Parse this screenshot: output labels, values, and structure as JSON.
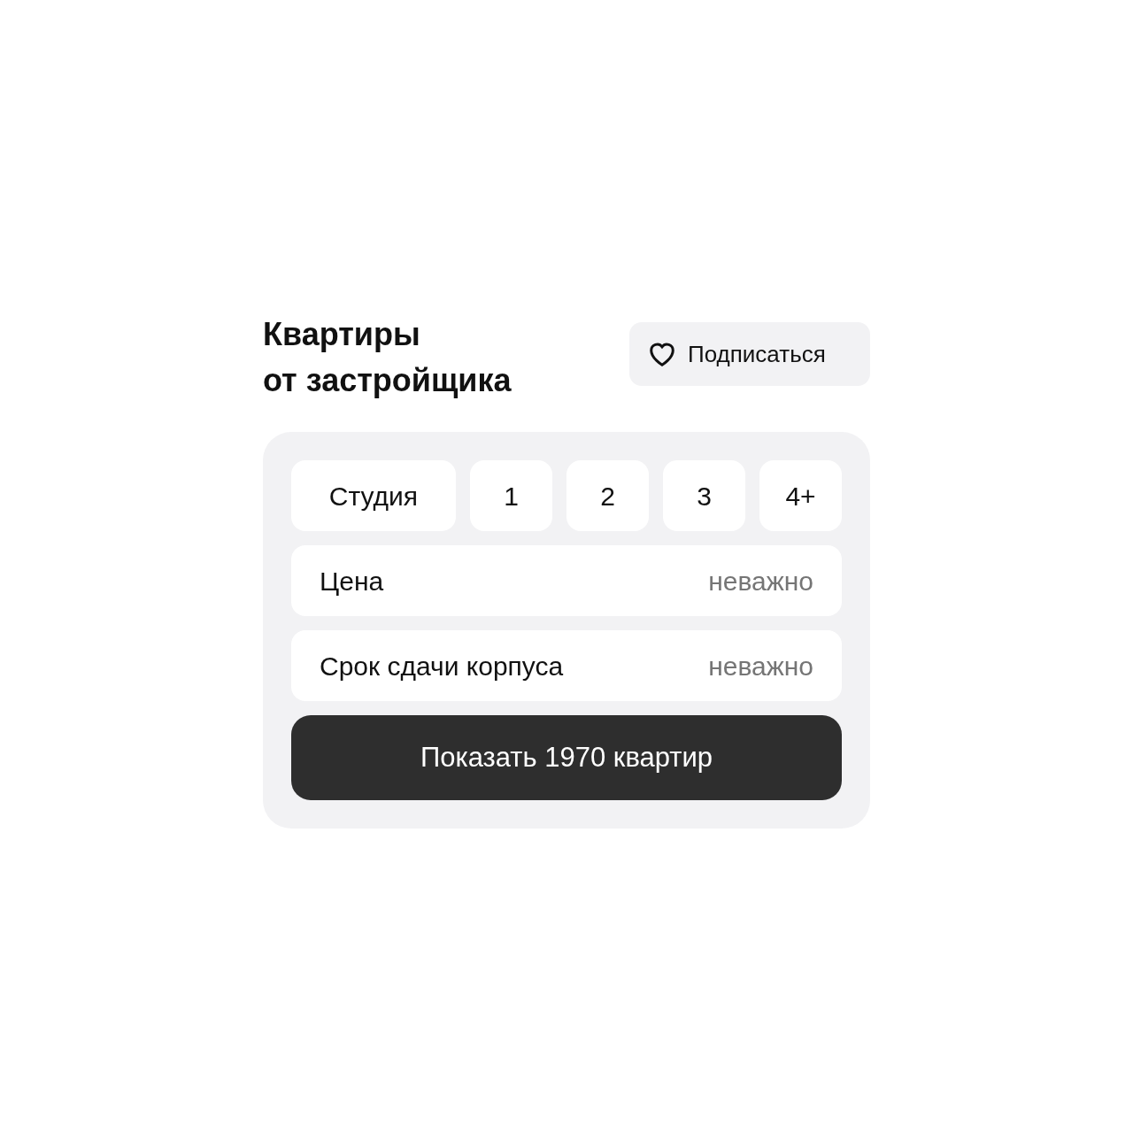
{
  "header": {
    "title_lines": [
      "Квартиры",
      "от застройщика"
    ],
    "subscribe_button": "Подписаться"
  },
  "rooms": [
    {
      "label": "Студия",
      "kind": "wide"
    },
    {
      "label": "1",
      "kind": "narrow"
    },
    {
      "label": "2",
      "kind": "narrow"
    },
    {
      "label": "3",
      "kind": "narrow"
    },
    {
      "label": "4+",
      "kind": "narrow"
    }
  ],
  "filters": [
    {
      "label": "Цена",
      "value": "неважно"
    },
    {
      "label": "Срок сдачи корпуса",
      "value": "неважно"
    }
  ],
  "show_button": "Показать 1970 квартир"
}
